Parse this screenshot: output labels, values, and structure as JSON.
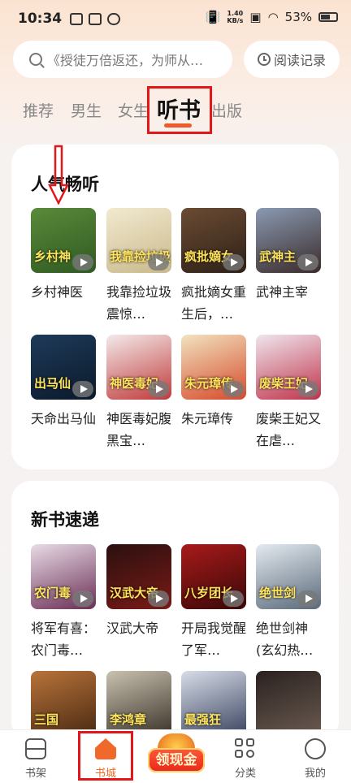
{
  "status_bar": {
    "time": "10:34",
    "speed_value": "1.40",
    "speed_unit": "KB/s",
    "battery": "53%"
  },
  "search": {
    "placeholder": "《授徒万倍返还，为师从…",
    "history_label": "阅读记录"
  },
  "tabs": [
    "推荐",
    "男生",
    "女生",
    "听书",
    "出版"
  ],
  "active_tab": "听书",
  "sections": [
    {
      "title": "人气畅听",
      "books": [
        {
          "title": "乡村神医",
          "cover_text": "乡村神",
          "cover_colors": [
            "#5a8a3a",
            "#2f5a22"
          ]
        },
        {
          "title": "我靠捡垃圾震惊…",
          "cover_text": "我靠捡垃圾",
          "cover_colors": [
            "#f2e9d0",
            "#c9b98a"
          ]
        },
        {
          "title": "疯批嫡女重生后，…",
          "cover_text": "疯批嫡女",
          "cover_colors": [
            "#6b4b33",
            "#2e2118"
          ]
        },
        {
          "title": "武神主宰",
          "cover_text": "武神主",
          "cover_colors": [
            "#8a9ab2",
            "#3a2b2a"
          ]
        },
        {
          "title": "天命出马仙",
          "cover_text": "出马仙",
          "cover_colors": [
            "#1e3a5a",
            "#0b1a2a"
          ]
        },
        {
          "title": "神医毒妃腹黑宝…",
          "cover_text": "神医毒妃",
          "cover_colors": [
            "#f3eaea",
            "#c13a3a"
          ]
        },
        {
          "title": "朱元璋传",
          "cover_text": "朱元璋传",
          "cover_colors": [
            "#f1e3c0",
            "#d64a2a"
          ]
        },
        {
          "title": "废柴王妃又在虐…",
          "cover_text": "废柴王妃",
          "cover_colors": [
            "#efe6ee",
            "#c0334a"
          ]
        }
      ]
    },
    {
      "title": "新书速递",
      "books": [
        {
          "title": "将军有喜：农门毒…",
          "cover_text": "农门毒",
          "cover_colors": [
            "#e9dbe6",
            "#6a2f55"
          ]
        },
        {
          "title": "汉武大帝",
          "cover_text": "汉武大帝",
          "cover_colors": [
            "#2a1010",
            "#7a1a15"
          ]
        },
        {
          "title": "开局我觉醒了军…",
          "cover_text": "八岁团长",
          "cover_colors": [
            "#a81a1a",
            "#3a0808"
          ]
        },
        {
          "title": "绝世剑神(玄幻热…",
          "cover_text": "绝世剑",
          "cover_colors": [
            "#e4eaf0",
            "#5a6a7a"
          ]
        },
        {
          "title": "",
          "cover_text": "三国",
          "cover_colors": [
            "#b8733a",
            "#4a2a12"
          ]
        },
        {
          "title": "",
          "cover_text": "李鸿章",
          "cover_colors": [
            "#c9c2b0",
            "#3a3228"
          ]
        },
        {
          "title": "",
          "cover_text": "最强狂",
          "cover_colors": [
            "#d8dde8",
            "#3a4460"
          ]
        },
        {
          "title": "",
          "cover_text": "",
          "cover_colors": [
            "#2a2220",
            "#6a5a50"
          ]
        }
      ]
    }
  ],
  "bottom_nav": [
    {
      "label": "书架",
      "icon": "bookshelf-icon"
    },
    {
      "label": "书城",
      "icon": "home-icon"
    },
    {
      "label": "领现金",
      "icon": "cash-pot-icon"
    },
    {
      "label": "分类",
      "icon": "category-grid-icon"
    },
    {
      "label": "我的",
      "icon": "profile-icon"
    }
  ],
  "accent_color": "#ef6a2a",
  "annotation_color": "#e3161a"
}
